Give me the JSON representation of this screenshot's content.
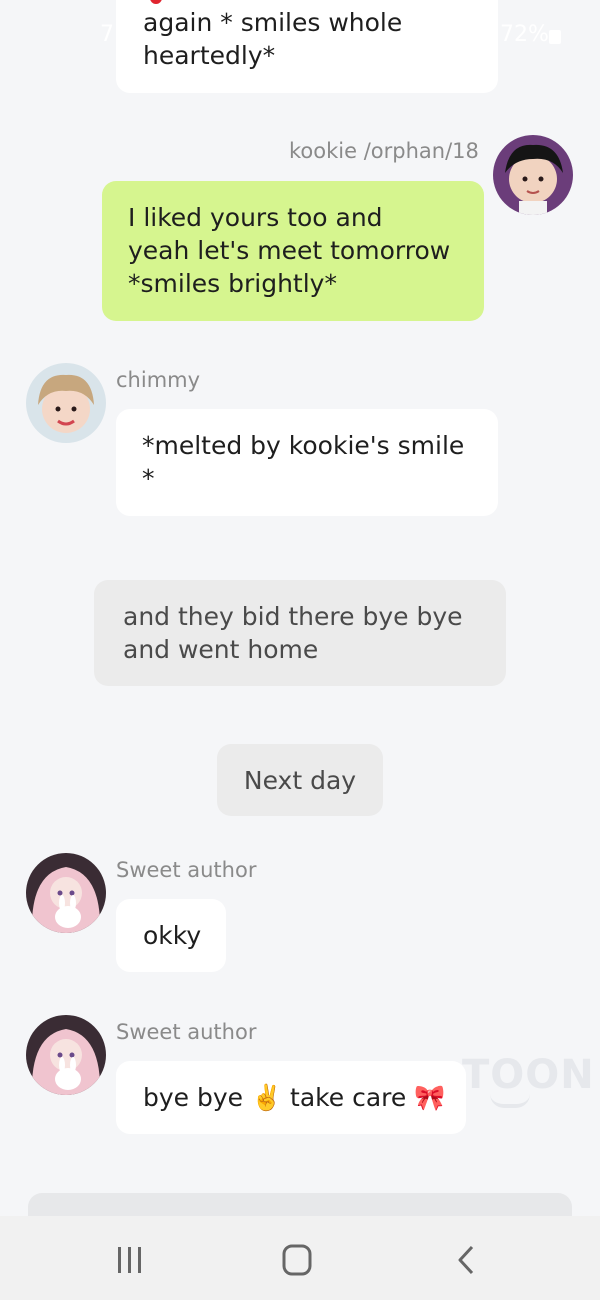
{
  "status_bar": {
    "time_partial": "7",
    "battery": "72%"
  },
  "messages": [
    {
      "sender": "",
      "text": "again * smiles whole\nheartedly*"
    },
    {
      "sender": "kookie /orphan/18",
      "text": "I liked yours too and\nyeah let's meet tomorrow\n*smiles brightly*"
    },
    {
      "sender": "chimmy",
      "text": "*melted by kookie's smile\n*"
    },
    {
      "sender": "",
      "text": "and they bid there bye bye\nand went home"
    },
    {
      "sender": "",
      "text": "Next day"
    },
    {
      "sender": "Sweet author",
      "text": "okky"
    },
    {
      "sender": "Sweet author",
      "text": "bye bye ✌️ take care 🎀"
    }
  ],
  "watermark": "TOON",
  "colors": {
    "background": "#f5f6f8",
    "bubble_white": "#ffffff",
    "bubble_green": "#d6f58f",
    "bubble_grey": "#ebebeb",
    "name_grey": "#8a8a8a"
  },
  "icons": {
    "nav_recent": "recent-apps-icon",
    "nav_home": "home-icon",
    "nav_back": "back-icon"
  }
}
